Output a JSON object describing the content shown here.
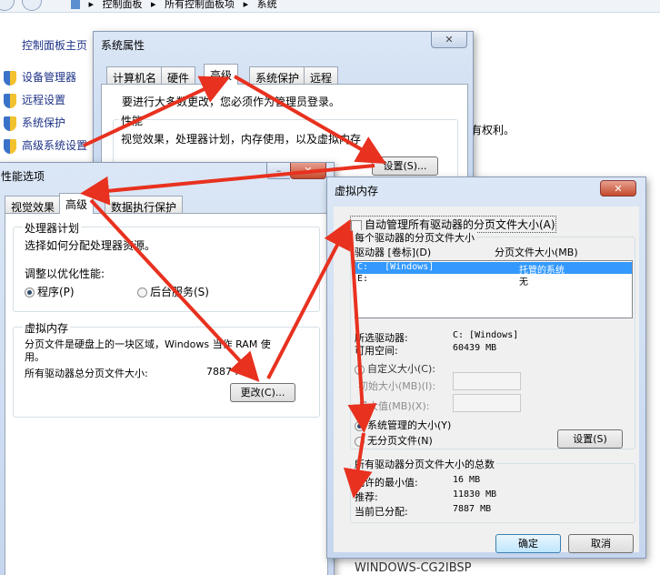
{
  "explorer": {
    "breadcrumb": [
      "控制面板",
      "所有控制面板项",
      "系统"
    ],
    "sidebar_title": "控制面板主页",
    "sidebar_items": [
      "设备管理器",
      "远程设置",
      "系统保护",
      "高级系统设置"
    ],
    "bg_text_rights": "有权利。",
    "bg_computer_name": "WINDOWS-CG2IBSP"
  },
  "sysprops": {
    "title": "系统属性",
    "tabs": [
      "计算机名",
      "硬件",
      "高级",
      "系统保护",
      "远程"
    ],
    "admin_note": "要进行大多数更改，您必须作为管理员登录。",
    "perf_group": "性能",
    "perf_desc": "视觉效果，处理器计划，内存使用，以及虚拟内存",
    "settings_btn": "设置(S)..."
  },
  "perfopts": {
    "title": "性能选项",
    "tabs": [
      "视觉效果",
      "高级",
      "数据执行保护"
    ],
    "cpu_group": "处理器计划",
    "cpu_desc": "选择如何分配处理器资源。",
    "adjust_label": "调整以优化性能:",
    "radio_programs": "程序(P)",
    "radio_services": "后台服务(S)",
    "vm_group": "虚拟内存",
    "vm_desc_1": "分页文件是硬盘上的一块区域，Windows 当作 RAM 使",
    "vm_desc_2": "用。",
    "total_label": "所有驱动器总分页文件大小:",
    "total_value": "7887 MB",
    "change_btn": "更改(C)..."
  },
  "virtmem": {
    "title": "虚拟内存",
    "auto_manage": "自动管理所有驱动器的分页文件大小(A)",
    "per_drive_group": "每个驱动器的分页文件大小",
    "col_drive": "驱动器 [卷标](D)",
    "col_size": "分页文件大小(MB)",
    "drives": [
      {
        "drive": "C:   [Windows]",
        "size": "托管的系统"
      },
      {
        "drive": "E:",
        "size": "无"
      }
    ],
    "selected_drive_label": "所选驱动器:",
    "selected_drive_value": "C:  [Windows]",
    "free_space_label": "可用空间:",
    "free_space_value": "60439 MB",
    "custom_size": "自定义大小(C):",
    "initial_size": "初始大小(MB)(I):",
    "max_size": "最大值(MB)(X):",
    "system_managed": "系统管理的大小(Y)",
    "no_paging": "无分页文件(N)",
    "set_btn": "设置(S)",
    "totals_group": "所有驱动器分页文件大小的总数",
    "min_label": "允许的最小值:",
    "min_value": "16 MB",
    "recommended_label": "推荐:",
    "recommended_value": "11830 MB",
    "allocated_label": "当前已分配:",
    "allocated_value": "7887 MB",
    "ok_btn": "确定",
    "cancel_btn": "取消"
  },
  "colors": {
    "arrow": "#e8311f",
    "selection": "#3399ff",
    "accent": "#2a5ea8"
  }
}
